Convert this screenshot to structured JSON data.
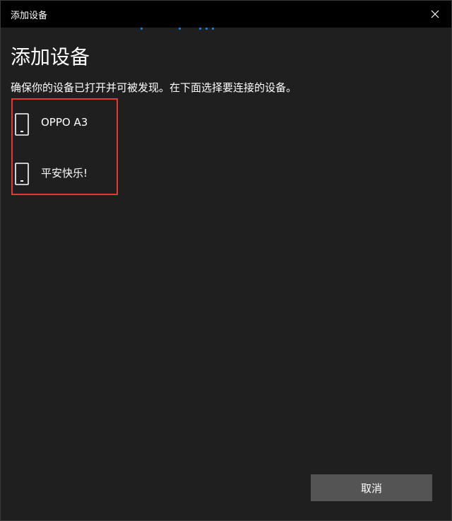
{
  "window": {
    "title": "添加设备"
  },
  "main": {
    "heading": "添加设备",
    "subtitle": "确保你的设备已打开并可被发现。在下面选择要连接的设备。",
    "devices": [
      {
        "name": "OPPO A3",
        "icon": "phone-icon"
      },
      {
        "name": "平安快乐!",
        "icon": "phone-icon"
      }
    ]
  },
  "footer": {
    "cancel_label": "取消"
  },
  "colors": {
    "background": "#1f1f1f",
    "titlebar": "#000000",
    "accent": "#1e88e5",
    "highlight_border": "#e53935",
    "button": "#545454"
  }
}
